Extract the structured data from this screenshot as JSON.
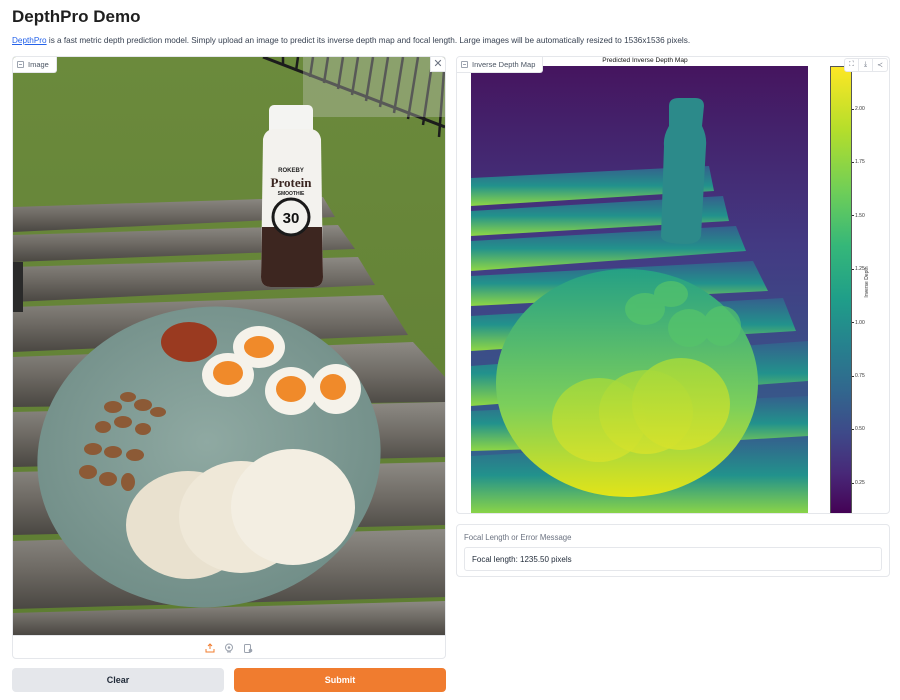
{
  "page": {
    "title": "DepthPro Demo",
    "description_link": "DepthPro",
    "description_text": " is a fast metric depth prediction model. Simply upload an image to predict its inverse depth map and focal length. Large images will be automatically resized to 1536x1536 pixels."
  },
  "input_image": {
    "label": "Image",
    "label_icon": "image-icon",
    "close_icon": "close-icon",
    "close_glyph": "✕",
    "photo_description": "Plate with rice cakes, boiled eggs, nuts and relish next to a Rokeby Protein Smoothie bottle on a wooden outdoor table",
    "bottle_text": {
      "brand": "ROKEBY",
      "product": "Protein",
      "sub": "SMOOTHIE",
      "grams": "30"
    },
    "sources": [
      {
        "name": "upload-icon",
        "active": true
      },
      {
        "name": "webcam-icon",
        "active": false
      },
      {
        "name": "clipboard-icon",
        "active": false
      }
    ]
  },
  "buttons": {
    "clear": "Clear",
    "submit": "Submit"
  },
  "output_depth": {
    "label": "Inverse Depth Map",
    "label_icon": "image-icon",
    "plot_title": "Predicted Inverse Depth Map",
    "colorbar_label": "Inverse Depth",
    "colormap": "viridis",
    "colorbar_ticks": [
      "2.00",
      "1.75",
      "1.50",
      "1.25",
      "1.00",
      "0.75",
      "0.50",
      "0.25"
    ],
    "colorbar_range": [
      0.1,
      2.2
    ],
    "toolbar": [
      {
        "name": "fullscreen-icon",
        "glyph": "⛶"
      },
      {
        "name": "download-icon",
        "glyph": "⤓"
      },
      {
        "name": "share-icon",
        "glyph": "≺"
      }
    ]
  },
  "focal": {
    "label": "Focal Length or Error Message",
    "value": "Focal length: 1235.50 pixels"
  },
  "colors": {
    "accent": "#f07c2f",
    "link": "#2563eb",
    "secondary_button": "#e5e7eb"
  }
}
